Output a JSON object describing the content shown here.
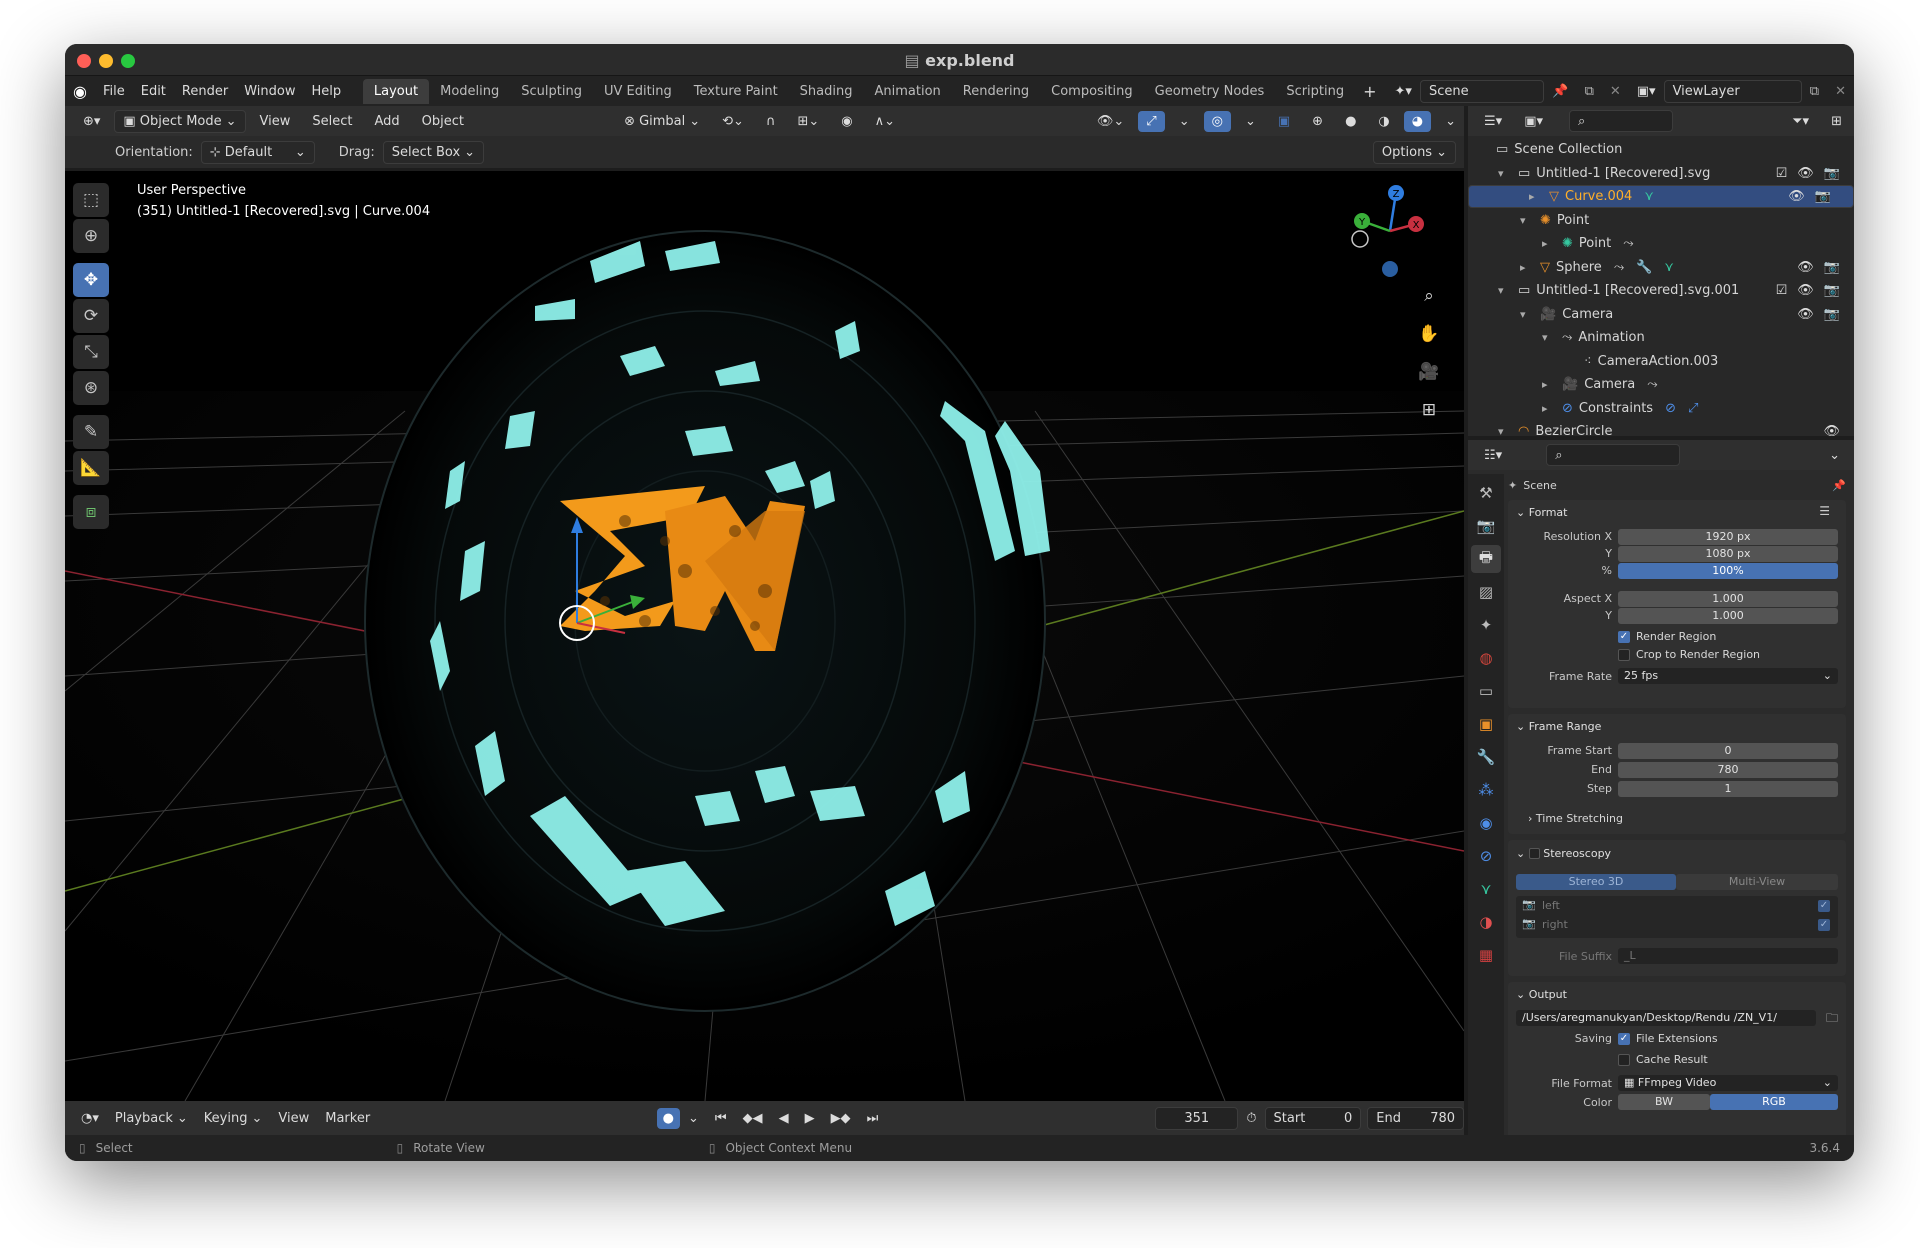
{
  "window": {
    "title": "exp.blend"
  },
  "menu": {
    "items": [
      "File",
      "Edit",
      "Render",
      "Window",
      "Help"
    ],
    "workspaces": [
      "Layout",
      "Modeling",
      "Sculpting",
      "UV Editing",
      "Texture Paint",
      "Shading",
      "Animation",
      "Rendering",
      "Compositing",
      "Geometry Nodes",
      "Scripting"
    ],
    "active_workspace": "Layout",
    "add_workspace": "+",
    "scene": "Scene",
    "view_layer": "ViewLayer"
  },
  "viewport_header": {
    "mode": "Object Mode",
    "menus": [
      "View",
      "Select",
      "Add",
      "Object"
    ],
    "transform_orientation": "Gimbal",
    "orientation_label": "Orientation:",
    "orientation_value": "Default",
    "drag_label": "Drag:",
    "drag_value": "Select Box",
    "options": "Options"
  },
  "viewport": {
    "view_name": "User Perspective",
    "object_info": "(351) Untitled-1 [Recovered].svg | Curve.004",
    "gizmo_axes": [
      "Z",
      "Y",
      "X"
    ]
  },
  "timeline": {
    "menus": [
      "Playback",
      "Keying",
      "View",
      "Marker"
    ],
    "current_frame": "351",
    "start_label": "Start",
    "start_value": "0",
    "end_label": "End",
    "end_value": "780"
  },
  "statusbar": {
    "items": [
      "Select",
      "Rotate View",
      "Object Context Menu"
    ],
    "version": "3.6.4"
  },
  "outliner": {
    "rows": [
      {
        "label": "Scene Collection",
        "level": 0,
        "expand": "",
        "color": "#d6d6d6"
      },
      {
        "label": "Untitled-1 [Recovered].svg",
        "level": 1,
        "expand": "▾",
        "color": "#d6d6d6"
      },
      {
        "label": "Curve.004",
        "level": 2,
        "expand": "▸",
        "color": "#ffaf29",
        "selected": true
      },
      {
        "label": "Point",
        "level": 2,
        "expand": "▾",
        "color": "#d6d6d6"
      },
      {
        "label": "Point",
        "level": 3,
        "expand": "▸",
        "color": "#d6d6d6"
      },
      {
        "label": "Sphere",
        "level": 2,
        "expand": "▸",
        "color": "#d6d6d6"
      },
      {
        "label": "Untitled-1 [Recovered].svg.001",
        "level": 1,
        "expand": "▾",
        "color": "#d6d6d6"
      },
      {
        "label": "Camera",
        "level": 2,
        "expand": "▾",
        "color": "#d6d6d6"
      },
      {
        "label": "Animation",
        "level": 3,
        "expand": "▾",
        "color": "#d6d6d6"
      },
      {
        "label": "CameraAction.003",
        "level": 4,
        "expand": "",
        "color": "#d6d6d6"
      },
      {
        "label": "Camera",
        "level": 3,
        "expand": "▸",
        "color": "#d6d6d6"
      },
      {
        "label": "Constraints",
        "level": 3,
        "expand": "▸",
        "color": "#d6d6d6"
      },
      {
        "label": "BezierCircle",
        "level": 1,
        "expand": "▾",
        "color": "#d6d6d6"
      }
    ]
  },
  "properties": {
    "context": "Scene",
    "format": {
      "title": "Format",
      "resolution_x_label": "Resolution X",
      "resolution_x": "1920 px",
      "resolution_y_label": "Y",
      "resolution_y": "1080 px",
      "percent_label": "%",
      "percent": "100%",
      "aspect_x_label": "Aspect X",
      "aspect_x": "1.000",
      "aspect_y_label": "Y",
      "aspect_y": "1.000",
      "render_region": "Render Region",
      "crop_region": "Crop to Render Region",
      "frame_rate_label": "Frame Rate",
      "frame_rate": "25 fps"
    },
    "frame_range": {
      "title": "Frame Range",
      "start_label": "Frame Start",
      "start": "0",
      "end_label": "End",
      "end": "780",
      "step_label": "Step",
      "step": "1",
      "time_stretching": "Time Stretching"
    },
    "stereoscopy": {
      "title": "Stereoscopy",
      "tab_a": "Stereo 3D",
      "tab_b": "Multi-View",
      "left": "left",
      "right": "right",
      "file_suffix_label": "File Suffix",
      "file_suffix": "_L"
    },
    "output": {
      "title": "Output",
      "path": "/Users/aregmanukyan/Desktop/Rendu /ZN_V1/",
      "saving_label": "Saving",
      "file_extensions": "File Extensions",
      "cache_result": "Cache Result",
      "file_format_label": "File Format",
      "file_format": "FFmpeg Video",
      "color_label": "Color",
      "color_bw": "BW",
      "color_rgb": "RGB"
    }
  }
}
